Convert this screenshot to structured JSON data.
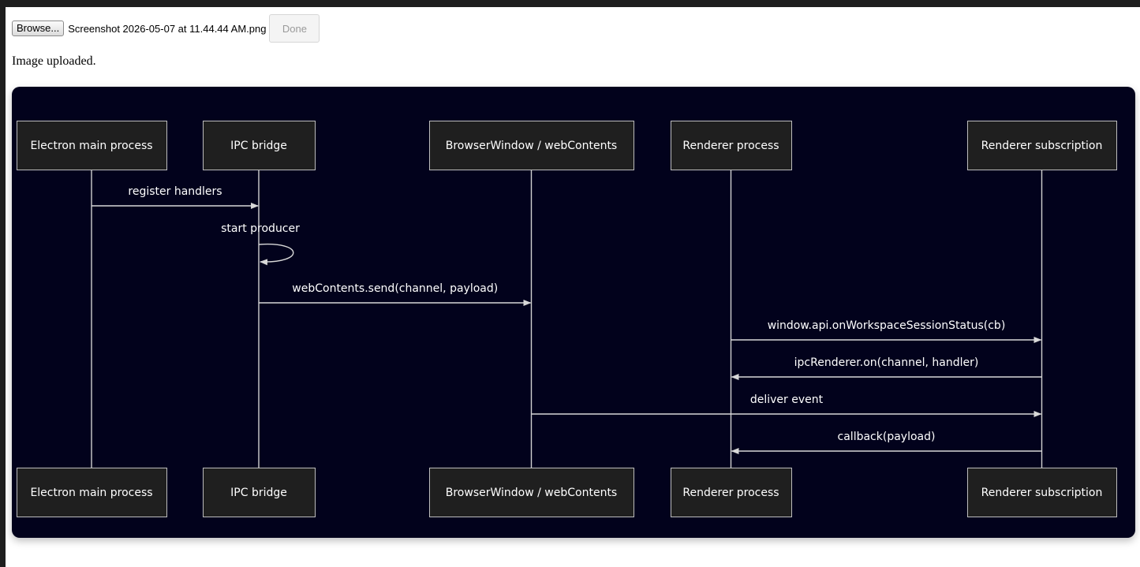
{
  "upload": {
    "browse_label": "Browse...",
    "file_name": "Screenshot 2026-05-07 at 11.44.44 AM.png",
    "done_label": "Done"
  },
  "status": {
    "message": "Image uploaded."
  },
  "diagram": {
    "participants": [
      "Electron main process",
      "IPC bridge",
      "BrowserWindow / webContents",
      "Renderer process",
      "Renderer subscription"
    ],
    "messages": [
      {
        "from": 0,
        "to": 1,
        "label": "register handlers"
      },
      {
        "from": 1,
        "to": 1,
        "label": "start producer"
      },
      {
        "from": 1,
        "to": 2,
        "label": "webContents.send(channel, payload)"
      },
      {
        "from": 3,
        "to": 4,
        "label": "window.api.onWorkspaceSessionStatus(cb)"
      },
      {
        "from": 4,
        "to": 3,
        "label": "ipcRenderer.on(channel, handler)"
      },
      {
        "from": 2,
        "to": 4,
        "label": "deliver event"
      },
      {
        "from": 4,
        "to": 3,
        "label": "callback(payload)"
      }
    ]
  }
}
